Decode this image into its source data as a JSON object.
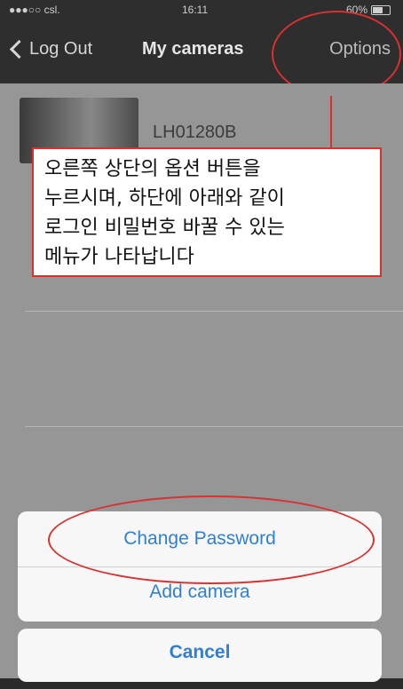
{
  "status_bar": {
    "carrier": "●●●○○ csl.",
    "time": "16:11",
    "battery": "60%",
    "battery_level": 0.6
  },
  "nav": {
    "back_label": "Log Out",
    "title": "My cameras",
    "options_label": "Options"
  },
  "cameras": [
    {
      "name": "LH01280B"
    }
  ],
  "callout": {
    "lines": [
      "오른쪽 상단의 옵션 버튼을",
      "누르시며, 하단에 아래와 같이",
      "로그인 비밀번호 바꿀 수 있는",
      "메뉴가 나타납니다"
    ]
  },
  "action_sheet": {
    "items": [
      {
        "label": "Change Password"
      },
      {
        "label": "Add camera"
      }
    ],
    "cancel_label": "Cancel"
  },
  "colors": {
    "accent": "#2f7fd6",
    "annotation": "#d93030",
    "nav_bg": "#2e2e2e"
  }
}
